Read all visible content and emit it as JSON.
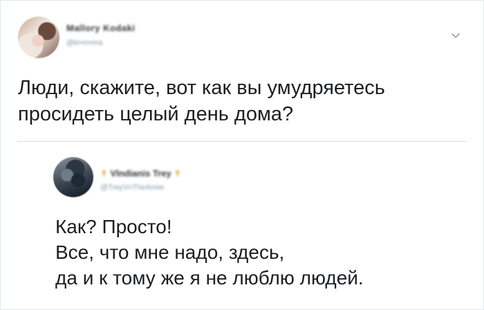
{
  "tweet1": {
    "author_name": "Mallory Kodaki",
    "author_handle": "@kr•m•ma",
    "text_lines": [
      "Люди, скажите, вот как вы умудряетесь",
      "просидеть целый день дома?"
    ],
    "menu_icon": "chevron-down-icon"
  },
  "tweet2": {
    "author_name_prefix": "✝",
    "author_name": "Vlndianis Trey",
    "author_name_suffix": "✝",
    "author_handle": "@TreyVnTheAmiw",
    "text_lines": [
      "Как? Просто!",
      "Все, что мне надо, здесь,",
      "да и к тому же я не люблю людей."
    ]
  },
  "colors": {
    "text": "#1c1e21",
    "muted": "#8899a6",
    "divider": "#d9dee2",
    "cross": "#c9a227"
  }
}
